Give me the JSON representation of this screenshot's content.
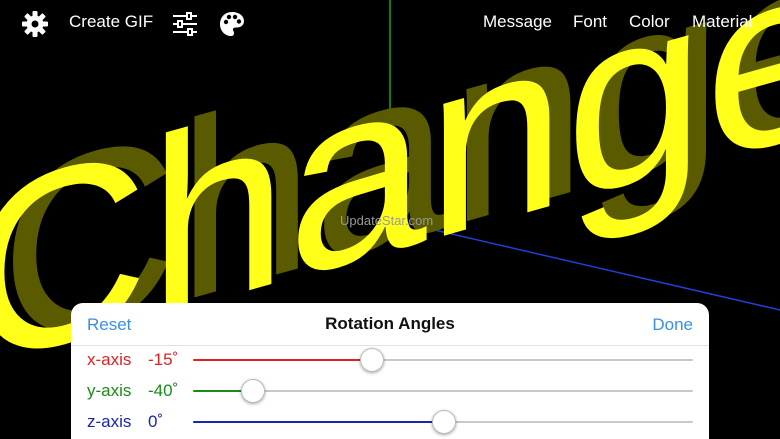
{
  "toolbar": {
    "settings_icon": "gear-icon",
    "create_gif_label": "Create GIF",
    "adjust_icon": "sliders-icon",
    "palette_icon": "palette-icon",
    "message_label": "Message",
    "font_label": "Font",
    "color_label": "Color",
    "material_label": "Material"
  },
  "scene": {
    "text": "Change fo",
    "text_color": "#ffff1a",
    "extrusion_color": "#5a5a00",
    "watermark": "UpdateStar.com",
    "green_axis_color": "#1aa31a",
    "blue_axis_color": "#1f3fd6"
  },
  "panel": {
    "reset_label": "Reset",
    "title": "Rotation Angles",
    "done_label": "Done",
    "accent_color": "#3b8fe0",
    "rows": [
      {
        "label": "x-axis",
        "value": "-15˚",
        "color": "#e02020",
        "fraction": 0.355
      },
      {
        "label": "y-axis",
        "value": "-40˚",
        "color": "#1a8a1a",
        "fraction": 0.118
      },
      {
        "label": "z-axis",
        "value": "0˚",
        "color": "#1a24b0",
        "fraction": 0.5
      }
    ]
  }
}
